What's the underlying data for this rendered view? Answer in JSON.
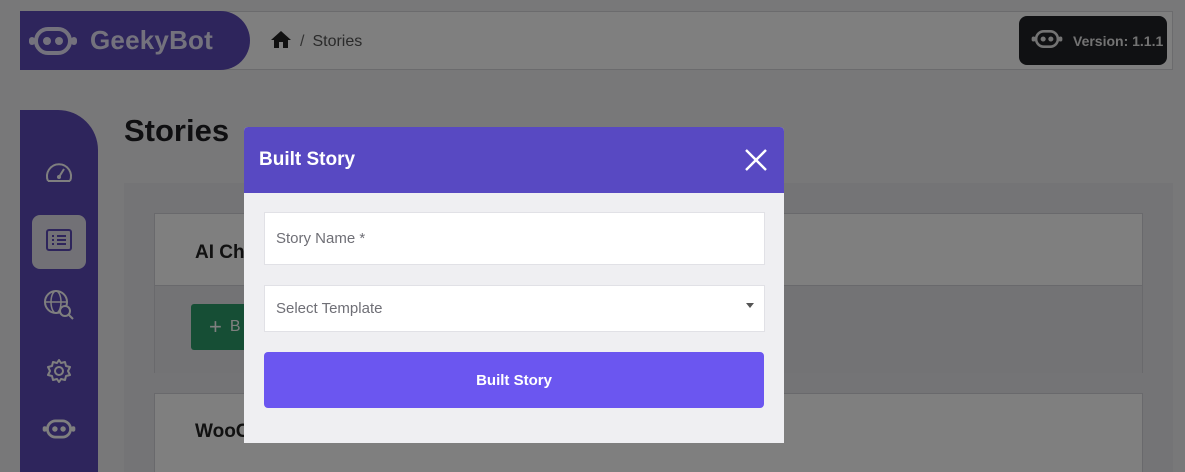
{
  "header": {
    "brand_name": "GeekyBot",
    "breadcrumb": [
      "Stories"
    ],
    "breadcrumb_separator": "/",
    "version_label": "Version: 1.1.1"
  },
  "sidebar": {
    "items": [
      {
        "icon": "dashboard-gauge-icon",
        "active": false
      },
      {
        "icon": "stories-list-icon",
        "active": true
      },
      {
        "icon": "globe-search-icon",
        "active": false
      },
      {
        "icon": "settings-gear-icon",
        "active": false
      },
      {
        "icon": "bot-icon",
        "active": false
      }
    ]
  },
  "main": {
    "title": "Stories",
    "cards": [
      {
        "title": "AI Cha",
        "button_label": "B"
      },
      {
        "title": "WooC"
      }
    ]
  },
  "modal": {
    "title": "Built Story",
    "story_name_placeholder": "Story Name *",
    "template_select_value": "Select Template",
    "submit_label": "Built Story"
  },
  "colors": {
    "brand_purple": "#5d4ab9",
    "modal_header": "#5849c2",
    "submit_button": "#6b56f0",
    "version_badge": "#202226",
    "green_button": "#2c9c6b"
  }
}
